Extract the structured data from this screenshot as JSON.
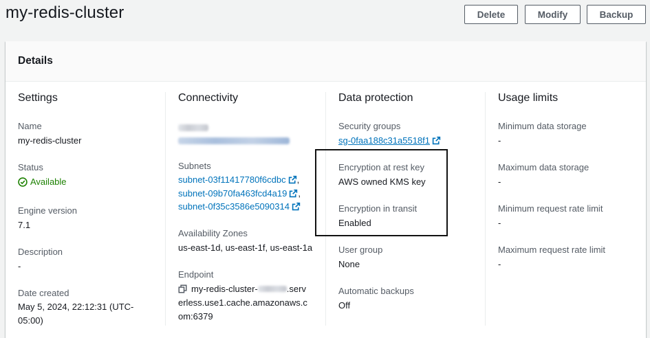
{
  "header": {
    "title": "my-redis-cluster",
    "buttons": {
      "delete": "Delete",
      "modify": "Modify",
      "backup": "Backup"
    }
  },
  "panel": {
    "title": "Details"
  },
  "settings": {
    "heading": "Settings",
    "name_label": "Name",
    "name_value": "my-redis-cluster",
    "status_label": "Status",
    "status_value": "Available",
    "engine_label": "Engine version",
    "engine_value": "7.1",
    "description_label": "Description",
    "description_value": "-",
    "created_label": "Date created",
    "created_value": "May 5, 2024, 22:12:31 (UTC-05:00)"
  },
  "connectivity": {
    "heading": "Connectivity",
    "subnets_label": "Subnets",
    "subnets": [
      "subnet-03f11417780f6cdbc",
      "subnet-09b70fa463fcd4a19",
      "subnet-0f35c3586e5090314"
    ],
    "az_label": "Availability Zones",
    "az_value": "us-east-1d, us-east-1f, us-east-1a",
    "endpoint_label": "Endpoint",
    "endpoint_prefix": "my-redis-cluster-",
    "endpoint_suffix": ".serverless.use1.cache.amazonaws.com:6379"
  },
  "data_protection": {
    "heading": "Data protection",
    "sg_label": "Security groups",
    "sg_value": "sg-0faa188c31a5518f1",
    "enc_rest_label": "Encryption at rest key",
    "enc_rest_value": "AWS owned KMS key",
    "enc_transit_label": "Encryption in transit",
    "enc_transit_value": "Enabled",
    "user_group_label": "User group",
    "user_group_value": "None",
    "backups_label": "Automatic backups",
    "backups_value": "Off"
  },
  "usage_limits": {
    "heading": "Usage limits",
    "min_storage_label": "Minimum data storage",
    "min_storage_value": "-",
    "max_storage_label": "Maximum data storage",
    "max_storage_value": "-",
    "min_rate_label": "Minimum request rate limit",
    "min_rate_value": "-",
    "max_rate_label": "Maximum request rate limit",
    "max_rate_value": "-"
  },
  "colors": {
    "link": "#0073bb",
    "success": "#1d8102",
    "text": "#16191f",
    "muted": "#545b64"
  }
}
